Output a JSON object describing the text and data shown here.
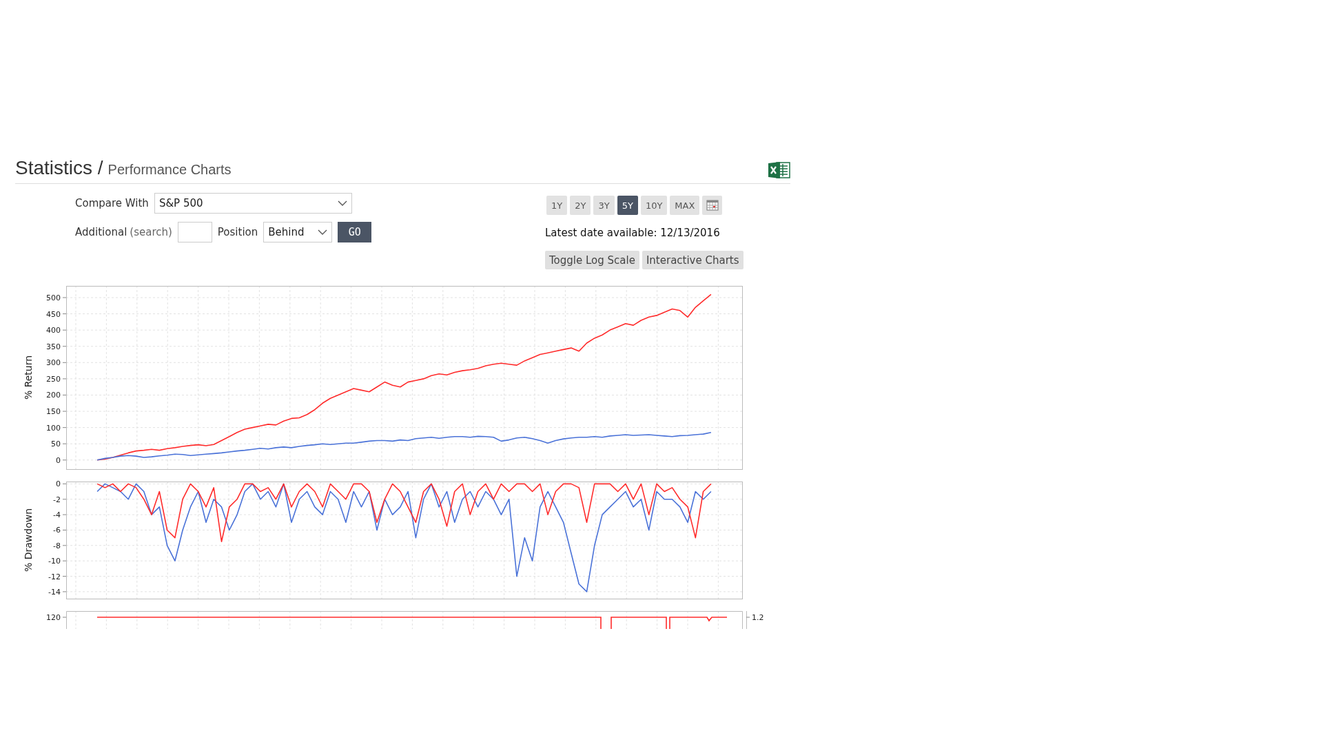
{
  "header": {
    "title": "Statistics /",
    "subtitle": "Performance Charts"
  },
  "compare": {
    "label": "Compare With",
    "value": "S&P 500"
  },
  "additional": {
    "label": "Additional",
    "link": "(search)",
    "position_label": "Position",
    "position_value": "Behind",
    "go": "GO"
  },
  "periods": [
    {
      "label": "1Y",
      "selected": false
    },
    {
      "label": "2Y",
      "selected": false
    },
    {
      "label": "3Y",
      "selected": false
    },
    {
      "label": "5Y",
      "selected": true
    },
    {
      "label": "10Y",
      "selected": false
    },
    {
      "label": "MAX",
      "selected": false
    }
  ],
  "latest_date": "Latest date available: 12/13/2016",
  "buttons": [
    "Toggle Log Scale",
    "Interactive Charts"
  ],
  "charts": [
    {
      "chart_data": {
        "type": "line",
        "ylabel": "% Return",
        "grid": true,
        "ylim": [
          -28,
          536
        ],
        "yticks": [
          0,
          50,
          100,
          150,
          200,
          250,
          300,
          350,
          400,
          450,
          500
        ],
        "series": [
          {
            "color": "#ff2b2b",
            "values": [
              0,
              3,
              8,
              15,
              22,
              28,
              30,
              33,
              30,
              35,
              38,
              42,
              45,
              47,
              44,
              48,
              60,
              72,
              85,
              95,
              100,
              105,
              110,
              108,
              120,
              128,
              130,
              140,
              155,
              175,
              190,
              200,
              210,
              220,
              215,
              210,
              225,
              240,
              230,
              225,
              240,
              245,
              250,
              260,
              265,
              262,
              270,
              275,
              278,
              282,
              290,
              295,
              298,
              295,
              292,
              305,
              315,
              325,
              330,
              335,
              340,
              345,
              335,
              360,
              375,
              385,
              400,
              410,
              420,
              415,
              430,
              440,
              445,
              455,
              465,
              460,
              440,
              470,
              490,
              510
            ]
          },
          {
            "color": "#4a72d8",
            "values": [
              0,
              5,
              8,
              12,
              14,
              12,
              8,
              10,
              13,
              15,
              18,
              17,
              14,
              16,
              18,
              20,
              22,
              25,
              28,
              30,
              33,
              36,
              34,
              38,
              40,
              38,
              42,
              45,
              47,
              50,
              48,
              50,
              52,
              52,
              55,
              58,
              60,
              60,
              58,
              62,
              60,
              66,
              68,
              70,
              67,
              70,
              72,
              72,
              70,
              73,
              72,
              70,
              58,
              62,
              68,
              70,
              66,
              60,
              52,
              60,
              65,
              68,
              70,
              70,
              72,
              70,
              74,
              76,
              78,
              76,
              77,
              78,
              76,
              74,
              72,
              75,
              76,
              78,
              80,
              85
            ]
          }
        ]
      }
    },
    {
      "chart_data": {
        "type": "line",
        "ylabel": "% Drawdown",
        "grid": true,
        "ylim": [
          -14.9,
          0.3
        ],
        "yticks": [
          0,
          -2,
          -4,
          -6,
          -8,
          -10,
          -12,
          -14
        ],
        "series": [
          {
            "color": "#4a72d8",
            "values": [
              -1,
              0,
              -0.5,
              -1,
              -2,
              0,
              -1,
              -4,
              -3,
              -8,
              -10,
              -6,
              -3,
              -1,
              -5,
              -2,
              -3,
              -6,
              -4,
              -1,
              0,
              -2,
              -1,
              -3,
              0,
              -5,
              -2,
              -1,
              -3,
              -4,
              -1,
              -2,
              -5,
              -1,
              -3,
              -1,
              -6,
              -2,
              -4,
              -3,
              -1,
              -7,
              -2,
              0,
              -3,
              -1,
              -5,
              -2,
              -1,
              -3,
              -1,
              -2,
              -4,
              -2,
              -12,
              -7,
              -10,
              -3,
              -1,
              -3,
              -5,
              -9,
              -13,
              -14,
              -8,
              -4,
              -3,
              -2,
              -1,
              -3,
              -2,
              -6,
              -1,
              -2,
              -2,
              -3,
              -5,
              -1,
              -2,
              -1
            ]
          },
          {
            "color": "#ff2b2b",
            "values": [
              0,
              -0.5,
              0,
              -1,
              0,
              -0.5,
              -2,
              -4,
              -1,
              -6,
              -7,
              -2,
              0,
              -1,
              -3,
              -0.5,
              -7.5,
              -3,
              -2,
              0,
              0,
              -1,
              -0.5,
              -2,
              0,
              -3,
              -1,
              0,
              -1,
              -3,
              0,
              -1,
              -2,
              0,
              0,
              -1,
              -5,
              -2,
              0,
              -1,
              -3,
              -5,
              -1,
              0,
              -2,
              -5.5,
              -1,
              0,
              -4,
              -1,
              0,
              -2,
              0,
              -1,
              0,
              0,
              -1,
              0,
              -4,
              -1,
              0,
              0,
              -0.5,
              -5,
              0,
              0,
              0,
              -1,
              0,
              -2,
              0,
              -4,
              0,
              -1,
              -0.5,
              -2,
              -3,
              -7,
              -1,
              0
            ]
          }
        ]
      }
    },
    {
      "kind": "strip",
      "left_tick": "120",
      "right_tick": "1.2"
    }
  ]
}
